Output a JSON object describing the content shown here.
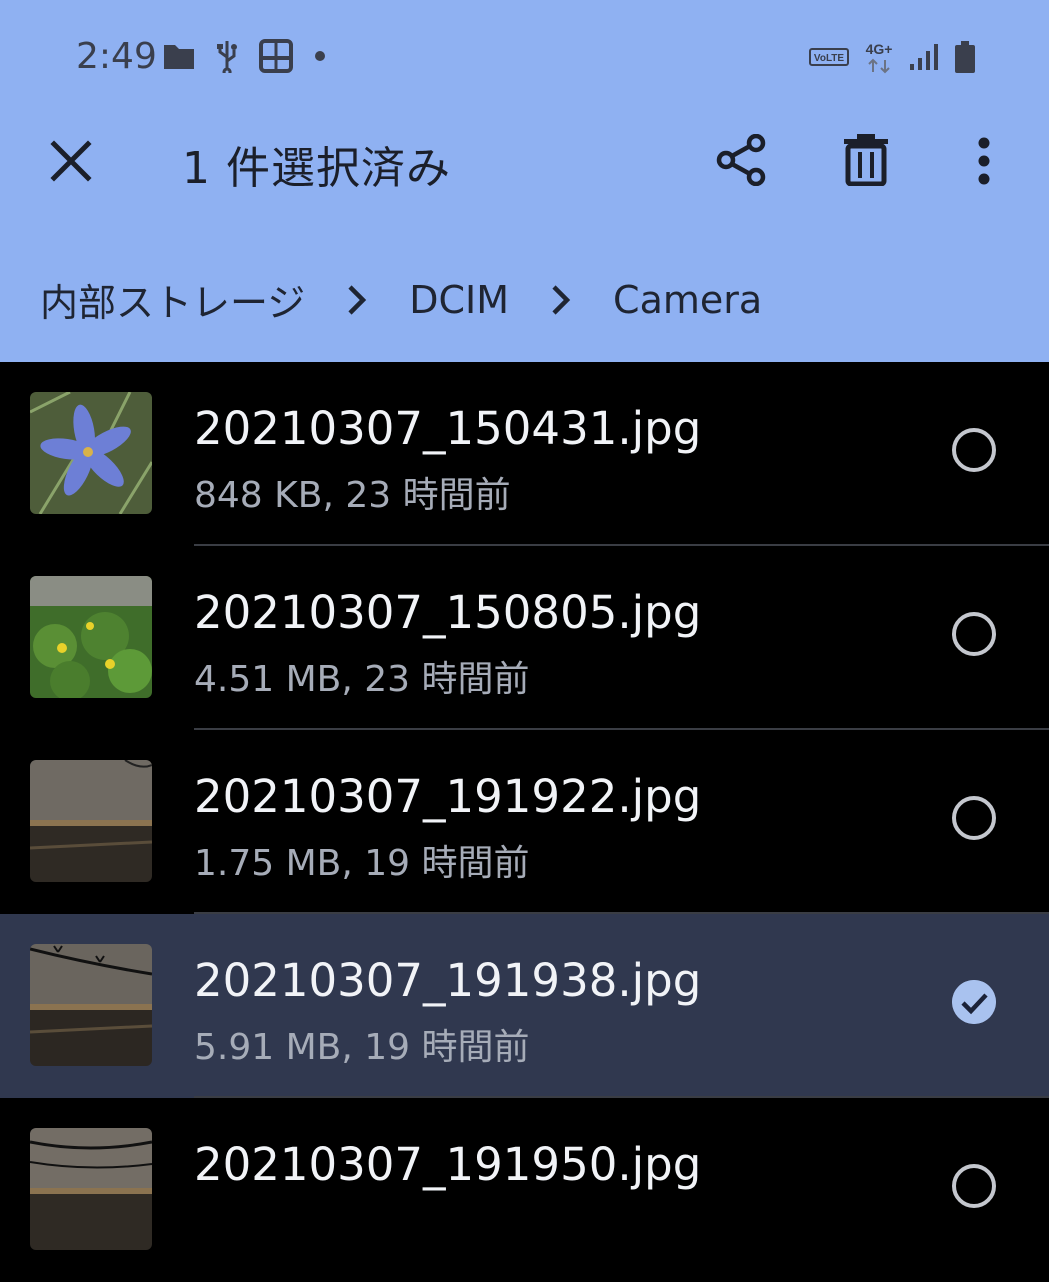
{
  "status_bar": {
    "time": "2:49",
    "left_icons": [
      "folder-icon",
      "usb-icon",
      "book-icon",
      "dot-icon"
    ],
    "right_icons": [
      "volte-icon",
      "4g-plus-icon",
      "signal-icon",
      "battery-icon"
    ],
    "volte": "VoLTE",
    "network": "4G+"
  },
  "action_bar": {
    "title": "1 件選択済み",
    "close_icon": "close-icon",
    "share_icon": "share-icon",
    "delete_icon": "trash-icon",
    "more_icon": "more-vert-icon"
  },
  "breadcrumb": {
    "items": [
      "内部ストレージ",
      "DCIM",
      "Camera"
    ]
  },
  "files": [
    {
      "name": "20210307_150431.jpg",
      "meta": "848 KB, 23 時間前",
      "selected": false
    },
    {
      "name": "20210307_150805.jpg",
      "meta": "4.51 MB, 23 時間前",
      "selected": false
    },
    {
      "name": "20210307_191922.jpg",
      "meta": "1.75 MB, 19 時間前",
      "selected": false
    },
    {
      "name": "20210307_191938.jpg",
      "meta": "5.91 MB, 19 時間前",
      "selected": true
    },
    {
      "name": "20210307_191950.jpg",
      "meta": "",
      "selected": false
    }
  ],
  "colors": {
    "header_bg": "#8fb1f2",
    "list_bg": "#000000",
    "selected_row_bg": "#30384f",
    "checkbox_checked": "#a9c2ef"
  }
}
